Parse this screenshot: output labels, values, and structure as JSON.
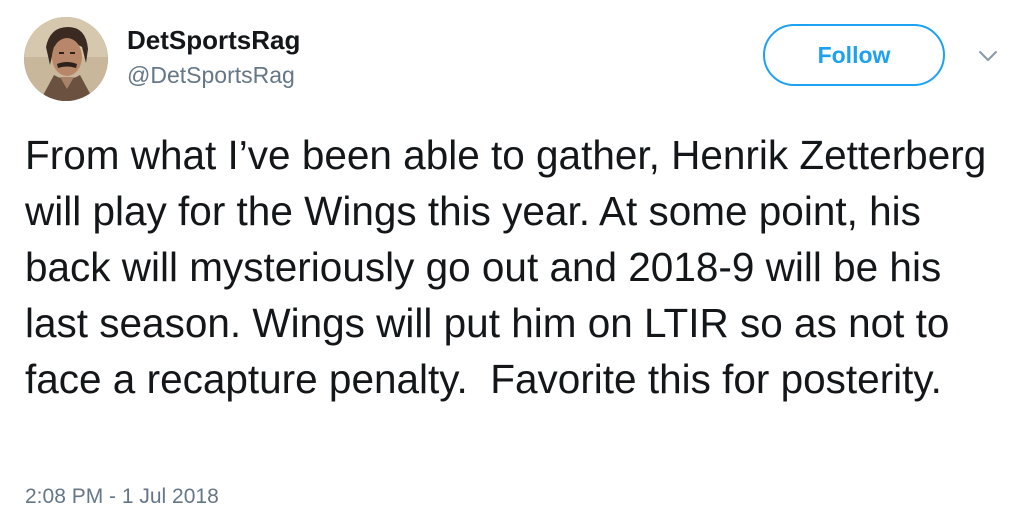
{
  "tweet": {
    "author": {
      "display_name": "DetSportsRag",
      "handle": "@DetSportsRag",
      "avatar_icon": "user-avatar-photo"
    },
    "follow_label": "Follow",
    "menu_icon": "chevron-down-icon",
    "text": "From what I’ve been able to gather, Henrik Zetterberg will play for the Wings this year. At some point, his back will mysteriously go out and 2018-9 will be his last season. Wings will put him on LTIR so as not to face a recapture penalty.  Favorite this for posterity.",
    "timestamp": "2:08 PM - 1 Jul 2018"
  },
  "colors": {
    "accent": "#1da1f2",
    "text_primary": "#14171a",
    "text_secondary": "#657786"
  }
}
